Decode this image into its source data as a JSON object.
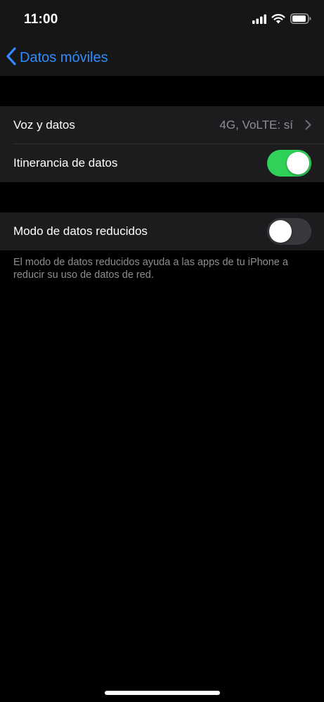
{
  "status_bar": {
    "time": "11:00",
    "icons": [
      "signal-icon",
      "wifi-icon",
      "battery-icon"
    ]
  },
  "nav": {
    "back_label": "Datos móviles"
  },
  "settings": {
    "voice_data": {
      "label": "Voz y datos",
      "value": "4G, VoLTE: sí"
    },
    "roaming": {
      "label": "Itinerancia de datos",
      "enabled": true
    },
    "low_data_mode": {
      "label": "Modo de datos reducidos",
      "enabled": false,
      "footer": "El modo de datos reducidos ayuda a las apps de tu iPhone a reducir su uso de datos de red."
    }
  },
  "colors": {
    "accent": "#2f8cff",
    "toggle_on": "#30d158",
    "toggle_off": "#39393d",
    "cell_background": "#1c1c1e",
    "secondary_text": "#8e8e93"
  }
}
